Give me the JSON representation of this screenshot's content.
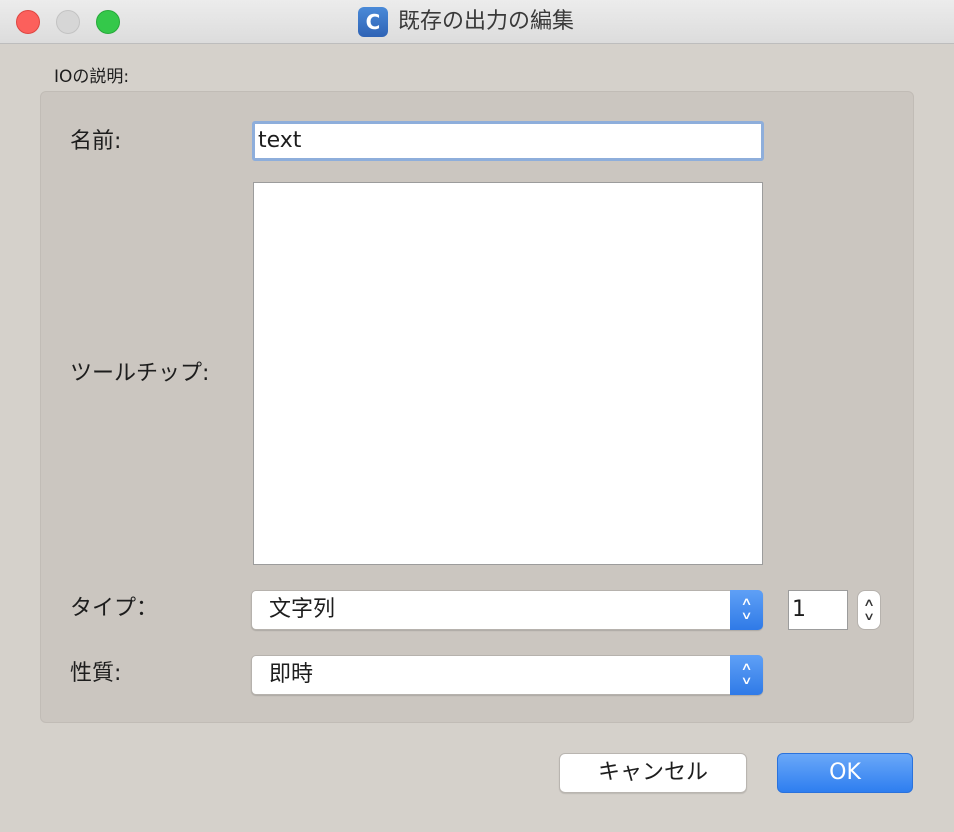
{
  "window": {
    "title": "既存の出力の編集",
    "app_icon_letter": "C"
  },
  "group": {
    "label": "IOの説明:"
  },
  "form": {
    "name_label": "名前:",
    "name_value": "text",
    "tooltip_label": "ツールチップ:",
    "tooltip_value": "",
    "type_label": "タイプ：",
    "type_value": "文字列",
    "count_value": "1",
    "nature_label": "性質:",
    "nature_value": "即時"
  },
  "buttons": {
    "cancel": "キャンセル",
    "ok": "OK"
  },
  "colors": {
    "accent": "#2f7ae7",
    "background": "#d5d1cb",
    "group_box": "#cbc6c0"
  },
  "icons": {
    "close": "close-icon",
    "minimize": "minimize-icon",
    "maximize": "maximize-icon",
    "select_arrows": "chevron-up-down-icon"
  }
}
